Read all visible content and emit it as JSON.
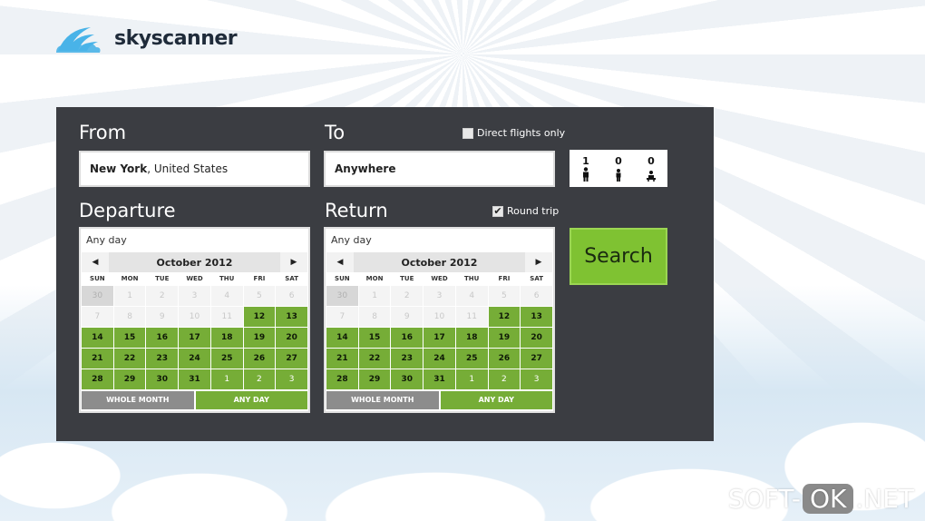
{
  "app": {
    "brand": "skyscanner"
  },
  "search": {
    "from_label": "From",
    "to_label": "To",
    "from_value_city": "New York",
    "from_value_country": ", United States",
    "to_value": "Anywhere",
    "direct_flights_label": "Direct flights only",
    "direct_flights_checked": false,
    "round_trip_label": "Round trip",
    "round_trip_checked": true,
    "round_trip_mark": "✔",
    "search_button": "Search"
  },
  "passengers": [
    {
      "count": "1",
      "icon": "adult-icon"
    },
    {
      "count": "0",
      "icon": "child-icon"
    },
    {
      "count": "0",
      "icon": "infant-icon"
    }
  ],
  "departure": {
    "label": "Departure",
    "any_day_text": "Any day",
    "month": "October 2012",
    "prev": "◀",
    "next": "▶",
    "whole_month": "WHOLE MONTH",
    "any_day_button": "ANY DAY"
  },
  "return": {
    "label": "Return",
    "any_day_text": "Any day",
    "month": "October 2012",
    "prev": "◀",
    "next": "▶",
    "whole_month": "WHOLE MONTH",
    "any_day_button": "ANY DAY"
  },
  "weekdays": [
    "SUN",
    "MON",
    "TUE",
    "WED",
    "THU",
    "FRI",
    "SAT"
  ],
  "calendar_days": [
    {
      "d": "30",
      "s": "first"
    },
    {
      "d": "1",
      "s": "past"
    },
    {
      "d": "2",
      "s": "past"
    },
    {
      "d": "3",
      "s": "past"
    },
    {
      "d": "4",
      "s": "past"
    },
    {
      "d": "5",
      "s": "past"
    },
    {
      "d": "6",
      "s": "past"
    },
    {
      "d": "7",
      "s": "past"
    },
    {
      "d": "8",
      "s": "past"
    },
    {
      "d": "9",
      "s": "past"
    },
    {
      "d": "10",
      "s": "past"
    },
    {
      "d": "11",
      "s": "past"
    },
    {
      "d": "12",
      "s": "avail"
    },
    {
      "d": "13",
      "s": "avail"
    },
    {
      "d": "14",
      "s": "avail"
    },
    {
      "d": "15",
      "s": "avail"
    },
    {
      "d": "16",
      "s": "avail"
    },
    {
      "d": "17",
      "s": "avail"
    },
    {
      "d": "18",
      "s": "avail"
    },
    {
      "d": "19",
      "s": "avail"
    },
    {
      "d": "20",
      "s": "avail"
    },
    {
      "d": "21",
      "s": "avail"
    },
    {
      "d": "22",
      "s": "avail"
    },
    {
      "d": "23",
      "s": "avail"
    },
    {
      "d": "24",
      "s": "avail"
    },
    {
      "d": "25",
      "s": "avail"
    },
    {
      "d": "26",
      "s": "avail"
    },
    {
      "d": "27",
      "s": "avail"
    },
    {
      "d": "28",
      "s": "avail"
    },
    {
      "d": "29",
      "s": "avail"
    },
    {
      "d": "30",
      "s": "avail"
    },
    {
      "d": "31",
      "s": "avail"
    },
    {
      "d": "1",
      "s": "next"
    },
    {
      "d": "2",
      "s": "next"
    },
    {
      "d": "3",
      "s": "next"
    }
  ],
  "watermark": {
    "left": "SOFT-",
    "ok": "OK",
    "right": ".NET"
  },
  "colors": {
    "panel": "#3b3d42",
    "accent_green": "#7fc232",
    "day_green": "#76ad37",
    "whole_month_gray": "#8c8c8c"
  }
}
